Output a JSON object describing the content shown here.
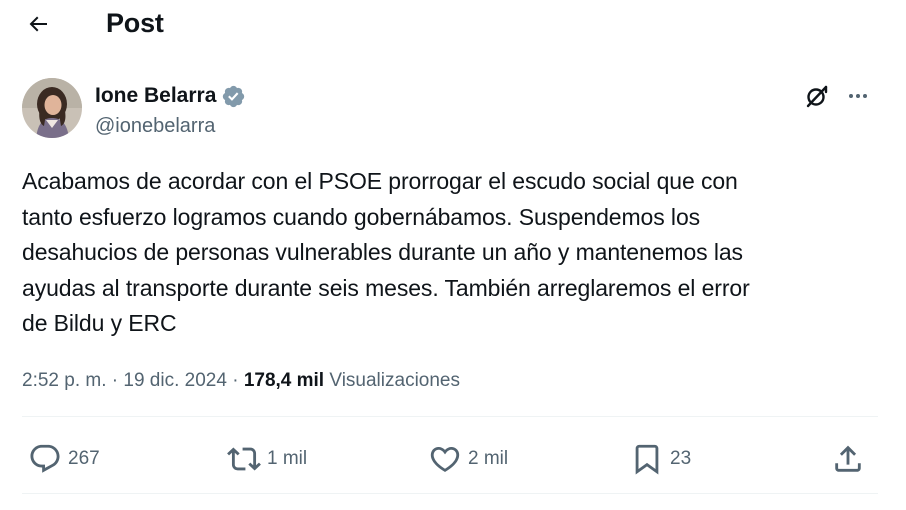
{
  "header": {
    "title": "Post",
    "back_icon": "arrow-left-icon"
  },
  "author": {
    "name": "Ione Belarra",
    "handle": "@ionebelarra",
    "verified_color": "#829aab"
  },
  "tweet": {
    "text": "Acabamos de acordar con el PSOE prorrogar el escudo social que con\ntanto esfuerzo logramos cuando gobernábamos. Suspendemos los\ndesahucios de personas vulnerables durante un año y mantenemos las\nayudas al transporte durante seis meses. También arreglaremos el error\nde Bildu y ERC"
  },
  "meta": {
    "time": "2:52 p. m.",
    "separator": "·",
    "date": "19 dic. 2024",
    "views_count": "178,4 mil",
    "views_label": "Visualizaciones"
  },
  "actions": {
    "replies": "267",
    "reposts": "1 mil",
    "likes": "2 mil",
    "bookmarks": "23"
  },
  "colors": {
    "text": "#0f1419",
    "secondary": "#536471",
    "divider": "#eff3f4"
  }
}
